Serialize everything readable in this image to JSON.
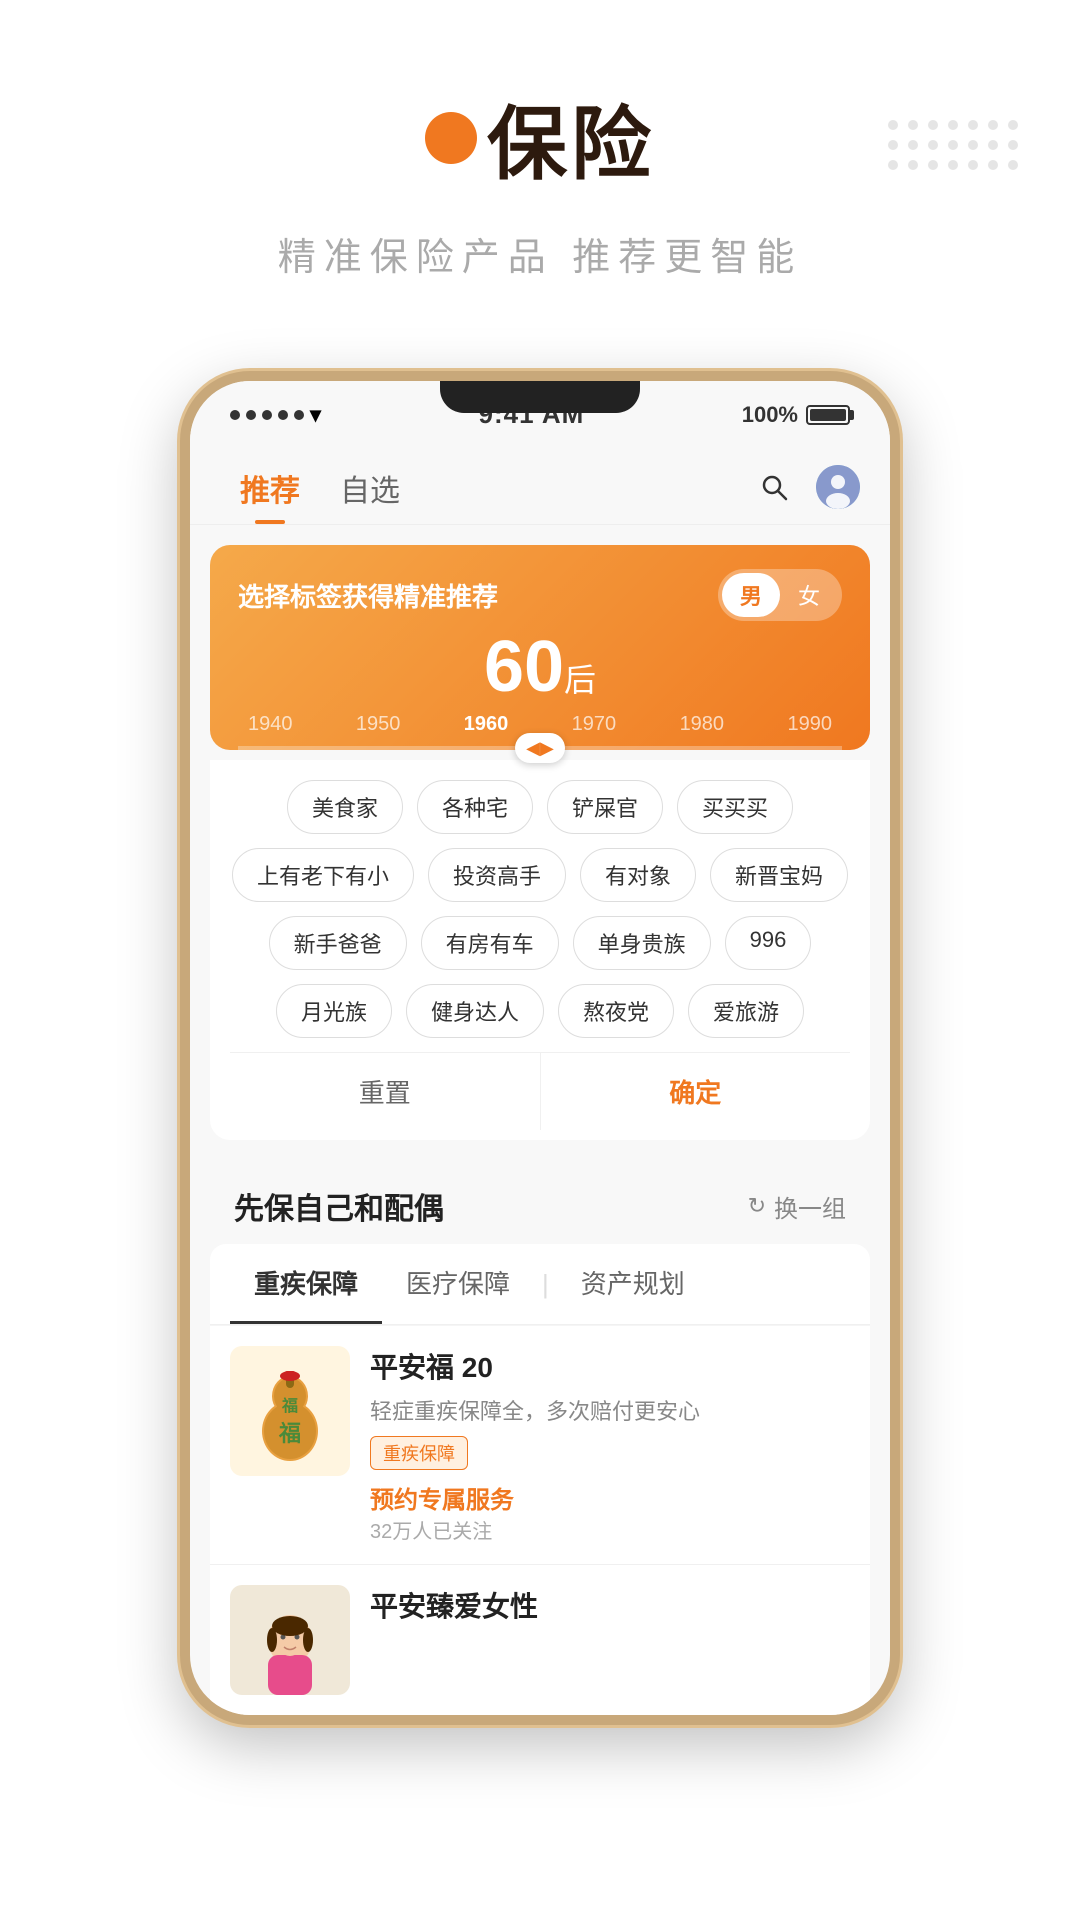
{
  "header": {
    "orange_dot": "orange-dot",
    "title": "保险",
    "subtitle": "精准保险产品   推荐更智能"
  },
  "status_bar": {
    "time": "9:41 AM",
    "battery": "100%"
  },
  "nav": {
    "tab_recommend": "推荐",
    "tab_custom": "自选"
  },
  "orange_card": {
    "title": "选择标签获得精准推荐",
    "gender_male": "男",
    "gender_female": "女",
    "age_number": "60",
    "age_suffix": "后",
    "timeline": [
      "1940",
      "1950",
      "1960",
      "1970",
      "1980",
      "1990"
    ]
  },
  "tags": {
    "row1": [
      "美食家",
      "各种宅",
      "铲屎官",
      "买买买"
    ],
    "row2": [
      "上有老下有小",
      "投资高手",
      "有对象",
      "新晋宝妈"
    ],
    "row3": [
      "新手爸爸",
      "有房有车",
      "单身贵族",
      "996"
    ],
    "row4": [
      "月光族",
      "健身达人",
      "熬夜党",
      "爱旅游"
    ]
  },
  "actions": {
    "reset": "重置",
    "confirm": "确定"
  },
  "section": {
    "title": "先保自己和配偶",
    "change_group": "换一组"
  },
  "product_tabs": {
    "tab1": "重疾保障",
    "tab2": "医疗保障",
    "tab3": "资产规划"
  },
  "products": [
    {
      "name": "平安福 20",
      "desc": "轻症重疾保障全，多次赔付更安心",
      "badge": "重疾保障",
      "action": "预约专属服务",
      "followers": "32万人已关注"
    },
    {
      "name": "平安臻爱女性"
    }
  ]
}
